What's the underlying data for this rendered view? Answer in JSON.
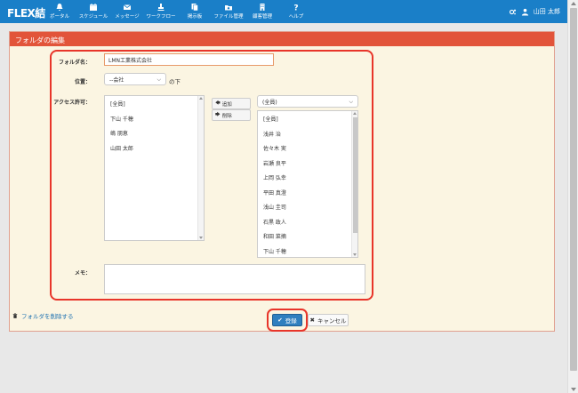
{
  "app": {
    "logo": "FLEX結"
  },
  "nav": [
    {
      "label": "ポータル",
      "icon": "bell-icon"
    },
    {
      "label": "スケジュール",
      "icon": "calendar-icon"
    },
    {
      "label": "メッセージ",
      "icon": "envelope-icon"
    },
    {
      "label": "ワークフロー",
      "icon": "stamp-icon"
    },
    {
      "label": "掲示板",
      "icon": "board-icon"
    },
    {
      "label": "ファイル管理",
      "icon": "folder-icon"
    },
    {
      "label": "顧客管理",
      "icon": "building-icon"
    },
    {
      "label": "ヘルプ",
      "icon": "question-icon"
    }
  ],
  "user": {
    "name": "山田 太郎"
  },
  "panel": {
    "title": "フォルダの編集"
  },
  "form": {
    "folder_name_label": "フォルダ名：",
    "folder_name_value": "LMN工業株式会社",
    "position_label": "位置：",
    "position_value": "--会社",
    "position_suffix": "の下",
    "access_label": "アクセス許可：",
    "add_button": "追加",
    "remove_button": "削除",
    "permitted": [
      "[全員]",
      "下山 千穂",
      "嶋 朋恵",
      "山田 太郎"
    ],
    "candidate_filter": "(全員)",
    "candidates": [
      "[全員]",
      "浅井 治",
      "佐々木 実",
      "岩瀬 良平",
      "上岡 弘幸",
      "平田 真澄",
      "浅山 圭司",
      "石黒 政人",
      "和田 菜摘",
      "下山 千穂"
    ],
    "memo_label": "メモ："
  },
  "actions": {
    "delete_folder": "フォルダを削除する",
    "register": "登録",
    "cancel": "キャンセル"
  },
  "colors": {
    "topbar": "#1a7fc8",
    "panel_header": "#e2543a",
    "highlight": "#e8352a",
    "primary_button": "#2f7fbf"
  }
}
